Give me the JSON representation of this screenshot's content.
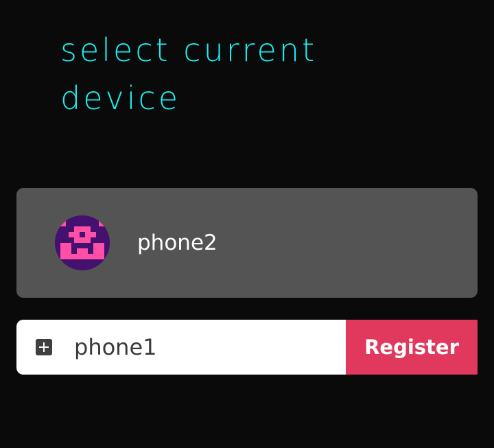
{
  "page": {
    "heading": "select current device"
  },
  "devices": [
    {
      "name": "phone2",
      "avatar_icon": "pixel-identicon",
      "avatar_colors": {
        "background": "#44116e",
        "foreground": "#ff4fa6"
      }
    }
  ],
  "register": {
    "input_value": "phone1",
    "button_label": "Register",
    "add_icon": "plus-square-icon"
  },
  "colors": {
    "page_background": "#0a0a0a",
    "heading": "#1cf0f4",
    "card_background": "#545454",
    "register_button": "#e1395e",
    "input_background": "#ffffff"
  }
}
